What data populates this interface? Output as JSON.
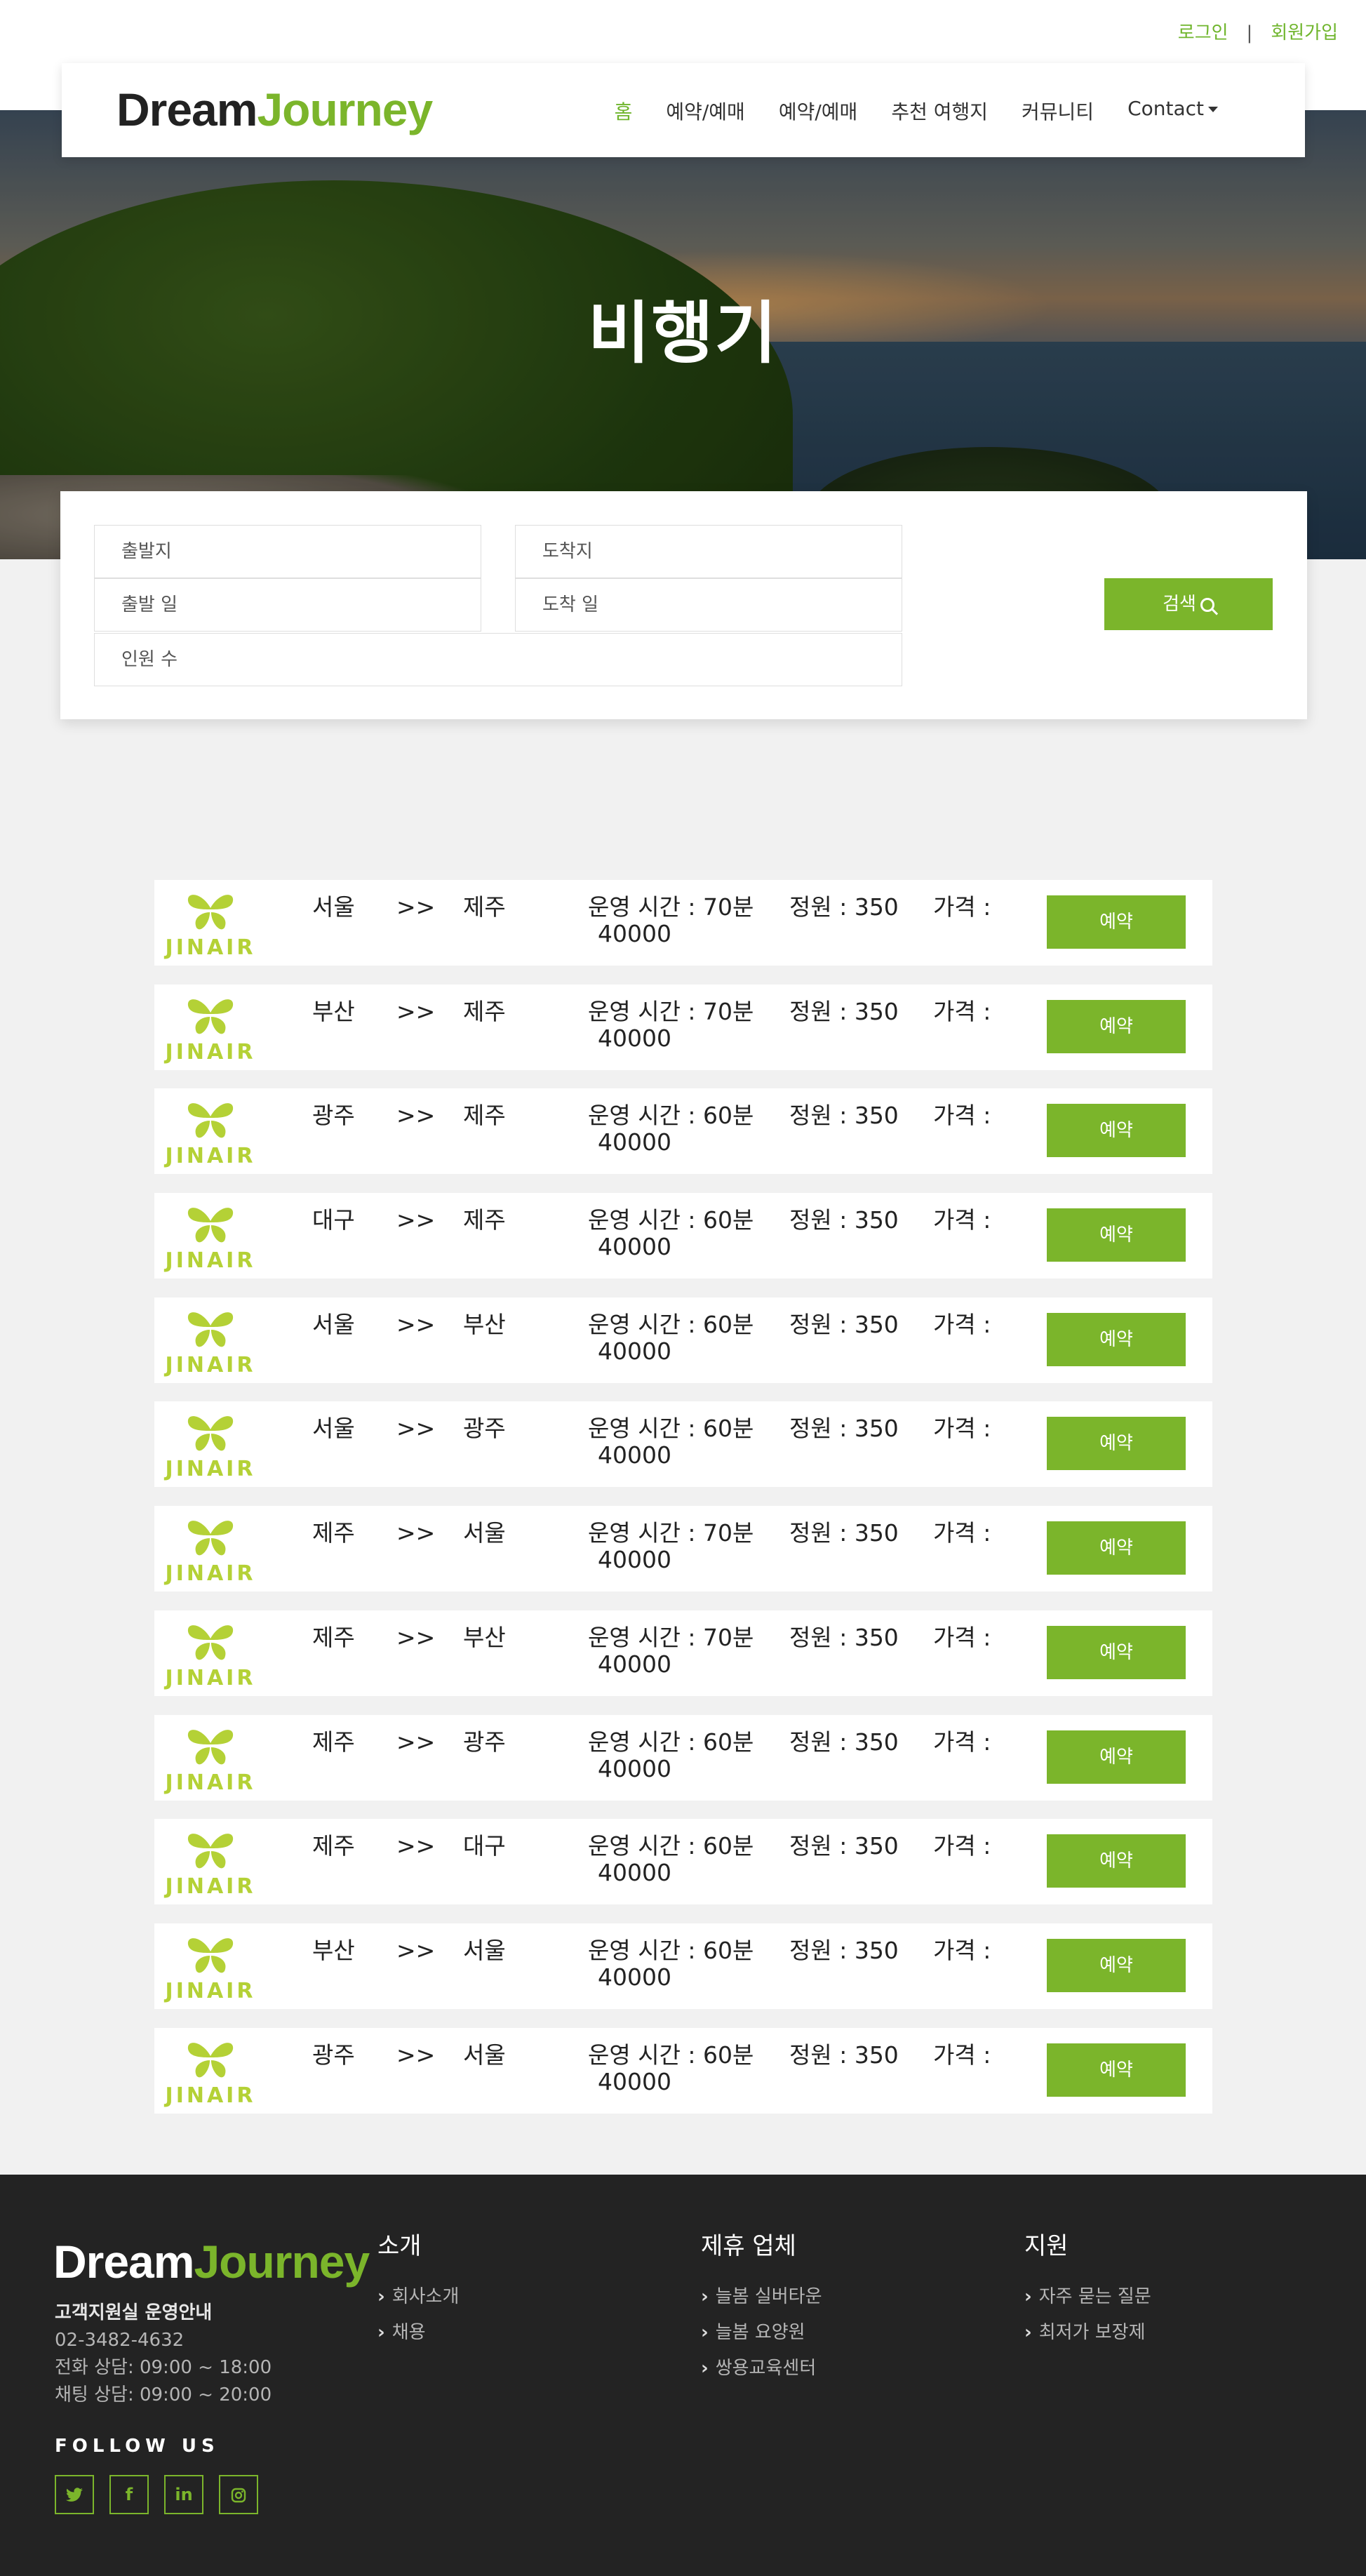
{
  "top_links": {
    "login": "로그인",
    "separator": "|",
    "signup": "회원가입"
  },
  "brand": {
    "part1": "Dream",
    "part2": "Journey"
  },
  "nav": {
    "home": "홈",
    "item2": "예약/예매",
    "item3": "예약/예매",
    "item4": "추천 여행지",
    "item5": "커뮤니티",
    "contact": "Contact"
  },
  "hero": {
    "title": "비행기"
  },
  "search": {
    "departure": "출발지",
    "arrival": "도착지",
    "departure_date": "출발 일",
    "arrival_date": "도착 일",
    "passengers": "인원 수",
    "button": "검색"
  },
  "airline_wordmark": "JINAIR",
  "flights": [
    {
      "from": "서울",
      "arrow": ">>",
      "to": "제주",
      "time": "운영 시간 : 70분",
      "capacity": "정원 : 350",
      "price_label": "가격 :",
      "price": "40000",
      "button": "예약"
    },
    {
      "from": "부산",
      "arrow": ">>",
      "to": "제주",
      "time": "운영 시간 : 70분",
      "capacity": "정원 : 350",
      "price_label": "가격 :",
      "price": "40000",
      "button": "예약"
    },
    {
      "from": "광주",
      "arrow": ">>",
      "to": "제주",
      "time": "운영 시간 : 60분",
      "capacity": "정원 : 350",
      "price_label": "가격 :",
      "price": "40000",
      "button": "예약"
    },
    {
      "from": "대구",
      "arrow": ">>",
      "to": "제주",
      "time": "운영 시간 : 60분",
      "capacity": "정원 : 350",
      "price_label": "가격 :",
      "price": "40000",
      "button": "예약"
    },
    {
      "from": "서울",
      "arrow": ">>",
      "to": "부산",
      "time": "운영 시간 : 60분",
      "capacity": "정원 : 350",
      "price_label": "가격 :",
      "price": "40000",
      "button": "예약"
    },
    {
      "from": "서울",
      "arrow": ">>",
      "to": "광주",
      "time": "운영 시간 : 60분",
      "capacity": "정원 : 350",
      "price_label": "가격 :",
      "price": "40000",
      "button": "예약"
    },
    {
      "from": "제주",
      "arrow": ">>",
      "to": "서울",
      "time": "운영 시간 : 70분",
      "capacity": "정원 : 350",
      "price_label": "가격 :",
      "price": "40000",
      "button": "예약"
    },
    {
      "from": "제주",
      "arrow": ">>",
      "to": "부산",
      "time": "운영 시간 : 70분",
      "capacity": "정원 : 350",
      "price_label": "가격 :",
      "price": "40000",
      "button": "예약"
    },
    {
      "from": "제주",
      "arrow": ">>",
      "to": "광주",
      "time": "운영 시간 : 60분",
      "capacity": "정원 : 350",
      "price_label": "가격 :",
      "price": "40000",
      "button": "예약"
    },
    {
      "from": "제주",
      "arrow": ">>",
      "to": "대구",
      "time": "운영 시간 : 60분",
      "capacity": "정원 : 350",
      "price_label": "가격 :",
      "price": "40000",
      "button": "예약"
    },
    {
      "from": "부산",
      "arrow": ">>",
      "to": "서울",
      "time": "운영 시간 : 60분",
      "capacity": "정원 : 350",
      "price_label": "가격 :",
      "price": "40000",
      "button": "예약"
    },
    {
      "from": "광주",
      "arrow": ">>",
      "to": "서울",
      "time": "운영 시간 : 60분",
      "capacity": "정원 : 350",
      "price_label": "가격 :",
      "price": "40000",
      "button": "예약"
    }
  ],
  "footer": {
    "info_title": "고객지원실 운영안내",
    "phone": "02-3482-4632",
    "phone_hours": "전화 상담: 09:00 ~ 18:00",
    "chat_hours": "채팅 상담: 09:00 ~ 20:00",
    "follow": "FOLLOW US",
    "socials": [
      "twitter-icon",
      "facebook-icon",
      "linkedin-icon",
      "instagram-icon"
    ],
    "col1": {
      "title": "소개",
      "links": [
        "회사소개",
        "채용"
      ]
    },
    "col2": {
      "title": "제휴 업체",
      "links": [
        "늘봄 실버타운",
        "늘봄 요양원",
        "쌍용교육센터"
      ]
    },
    "col3": {
      "title": "지원",
      "links": [
        "자주 묻는 질문",
        "최저가 보장제"
      ]
    }
  },
  "colors": {
    "accent": "#7bb52b",
    "logo_green": "#b4d136",
    "footer_bg": "#232323",
    "page_bg": "#f1f1f1"
  }
}
